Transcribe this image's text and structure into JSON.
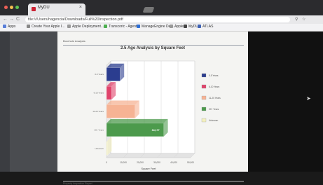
{
  "browser": {
    "tab_title": "MyDU",
    "tab_close": "×",
    "url": "file:///Users/hagencia/Downloads/Full%20Inspection.pdf",
    "back": "←",
    "forward": "→",
    "reload": "C",
    "zoom_icon": "search-icon",
    "star_icon": "star-icon",
    "bookmarks": [
      {
        "label": "Apps",
        "color": "#5a7fd8"
      },
      {
        "label": "Create Your Apple I...",
        "color": "#888888"
      },
      {
        "label": "Apple Deployment...",
        "color": "#999999"
      },
      {
        "label": "Transcoric - Agent",
        "color": "#4caf50"
      },
      {
        "label": "ManageEngine Des...",
        "color": "#2e6fd6"
      },
      {
        "label": "Apple",
        "color": "#999999"
      },
      {
        "label": "MyDU",
        "color": "#444444"
      },
      {
        "label": "ATLAS",
        "color": "#3f63b5"
      }
    ]
  },
  "pdf": {
    "header": "Borehole Analysis",
    "footer": "Property Inspection Report"
  },
  "chart_data": {
    "type": "bar",
    "title": "2.5  Age Analysis by Square Feet",
    "xlabel": "Square Feet",
    "categories": [
      "0-5 Years",
      "6-10 Years",
      "11-20 Years",
      "20+ Years",
      "Unknown"
    ],
    "values": [
      8000,
      3000,
      17000,
      34000,
      0
    ],
    "data_labels": [
      "",
      "",
      "",
      "34,177",
      ""
    ],
    "colors": [
      "#2b3d8f",
      "#e0436b",
      "#f6b394",
      "#4c9a4c",
      "#f3f0bf"
    ],
    "xlim": [
      0,
      50000
    ],
    "xticks": [
      "0",
      "10,000",
      "20,000",
      "30,000",
      "40,000",
      "50,000"
    ],
    "legend": [
      "0-5 Years",
      "6-10 Years",
      "11-20 Years",
      "20+ Years",
      "Unknown"
    ]
  },
  "colors": {
    "accent": "#4c9a4c",
    "page": "#f4f4f2",
    "viewer": "#4a4c50"
  }
}
